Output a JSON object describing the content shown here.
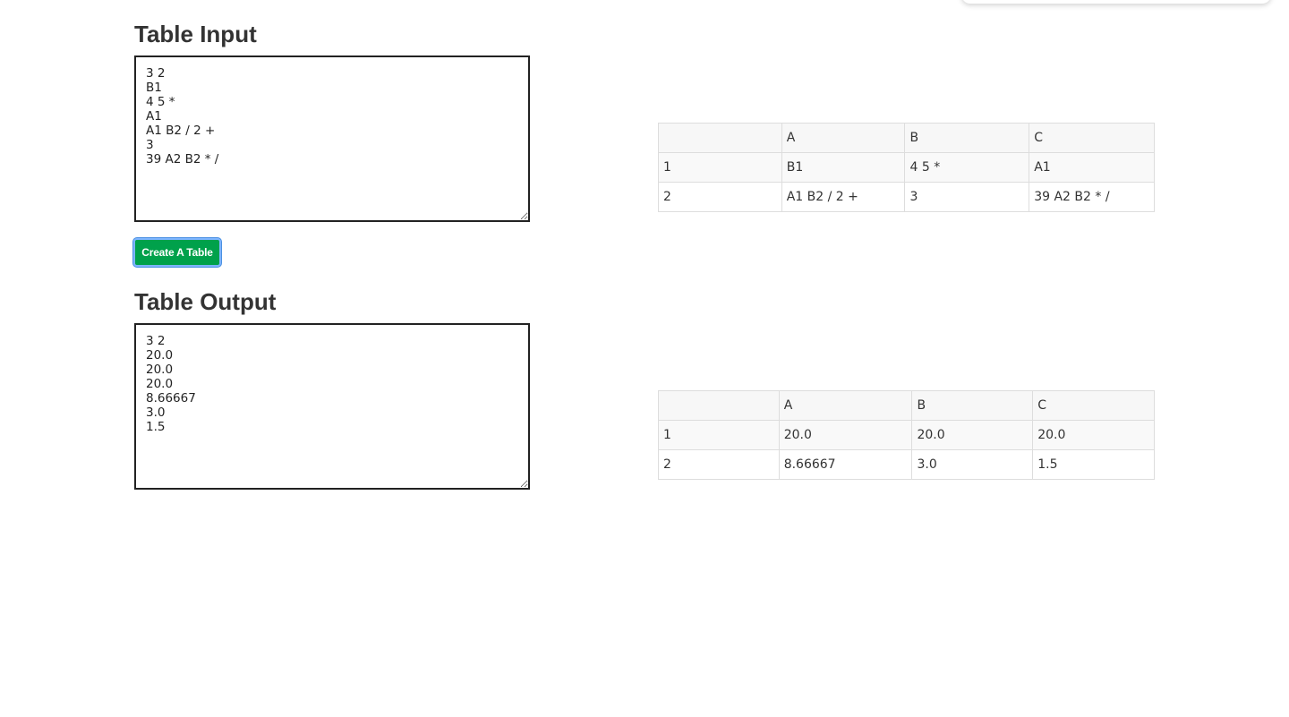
{
  "input_section": {
    "title": "Table Input",
    "textarea_value": "3 2\nB1\n4 5 *\nA1\nA1 B2 / 2 +\n3\n39 A2 B2 * /",
    "button_label": "Create A Table"
  },
  "output_section": {
    "title": "Table Output",
    "textarea_value": "3 2\n20.0\n20.0\n20.0\n8.66667\n3.0\n1.5"
  },
  "input_table": {
    "headers": [
      "",
      "A",
      "B",
      "C"
    ],
    "rows": [
      [
        "1",
        "B1",
        "4 5 *",
        "A1"
      ],
      [
        "2",
        "A1 B2 / 2 +",
        "3",
        "39 A2 B2 * /"
      ]
    ]
  },
  "output_table": {
    "headers": [
      "",
      "A",
      "B",
      "C"
    ],
    "rows": [
      [
        "1",
        "20.0",
        "20.0",
        "20.0"
      ],
      [
        "2",
        "8.66667",
        "3.0",
        "1.5"
      ]
    ]
  },
  "colors": {
    "button_bg": "#00a14b",
    "focus_ring": "#4a90e2",
    "table_border": "#dddddd"
  }
}
